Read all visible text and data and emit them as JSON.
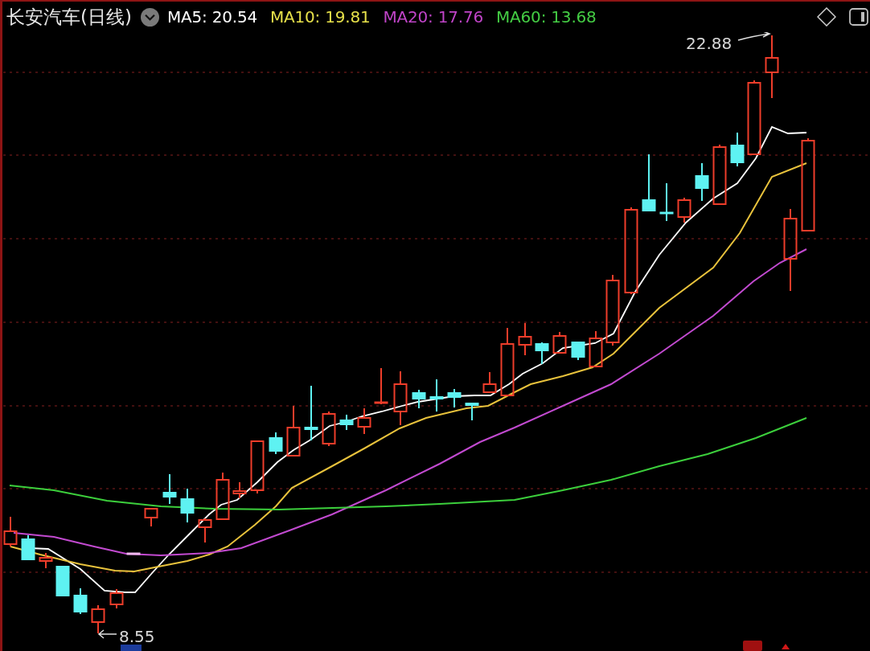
{
  "header": {
    "title": "长安汽车(日线)",
    "indicators": [
      {
        "label": "MA5: 20.54",
        "color": "#ffffff"
      },
      {
        "label": "MA10: 19.81",
        "color": "#e6e04a"
      },
      {
        "label": "MA20: 17.76",
        "color": "#c044c8"
      },
      {
        "label": "MA60: 13.68",
        "color": "#44cc44"
      }
    ]
  },
  "chart": {
    "high_label": "22.88",
    "low_label": "8.55"
  }
}
